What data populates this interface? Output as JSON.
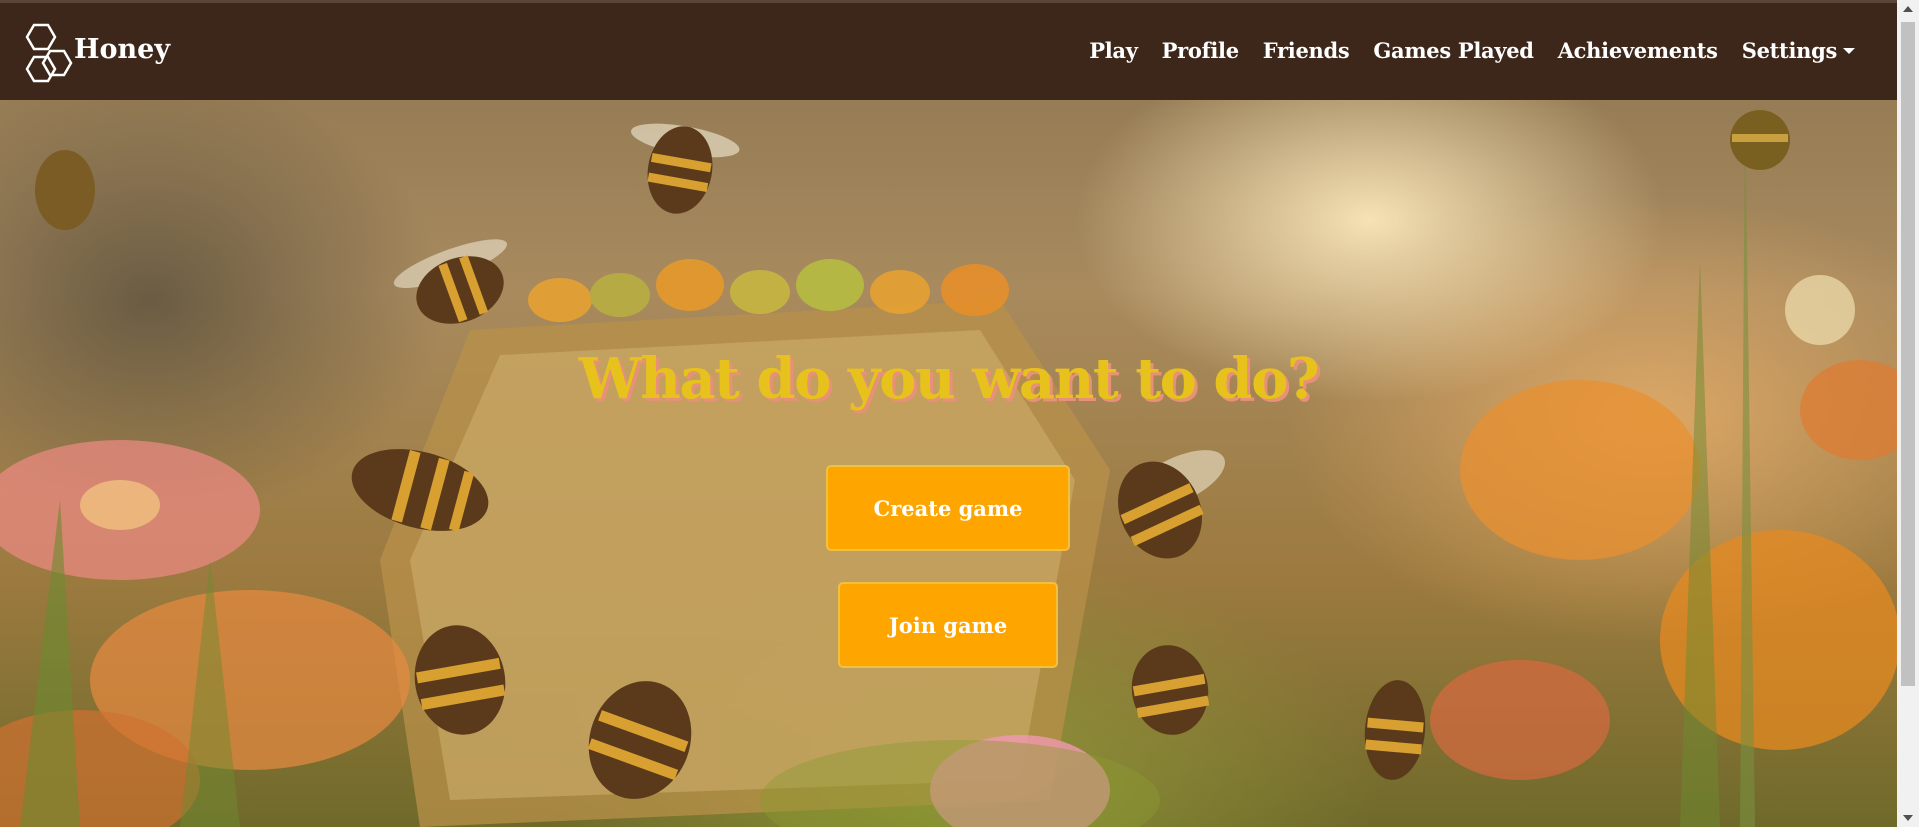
{
  "brand": {
    "name": "Honey",
    "logo_icon": "honeycomb-icon"
  },
  "nav": {
    "items": [
      {
        "label": "Play"
      },
      {
        "label": "Profile"
      },
      {
        "label": "Friends"
      },
      {
        "label": "Games Played"
      },
      {
        "label": "Achievements"
      },
      {
        "label": "Settings",
        "icon": "caret-down-icon"
      }
    ]
  },
  "main": {
    "headline": "What do you want to do?",
    "create_button": "Create game",
    "join_button": "Join game"
  },
  "colors": {
    "navbar": "#3d271a",
    "headline": "#e8c21c",
    "headline_shadow": "#e8907a",
    "button": "#ffa500",
    "button_text": "#ffffff"
  }
}
